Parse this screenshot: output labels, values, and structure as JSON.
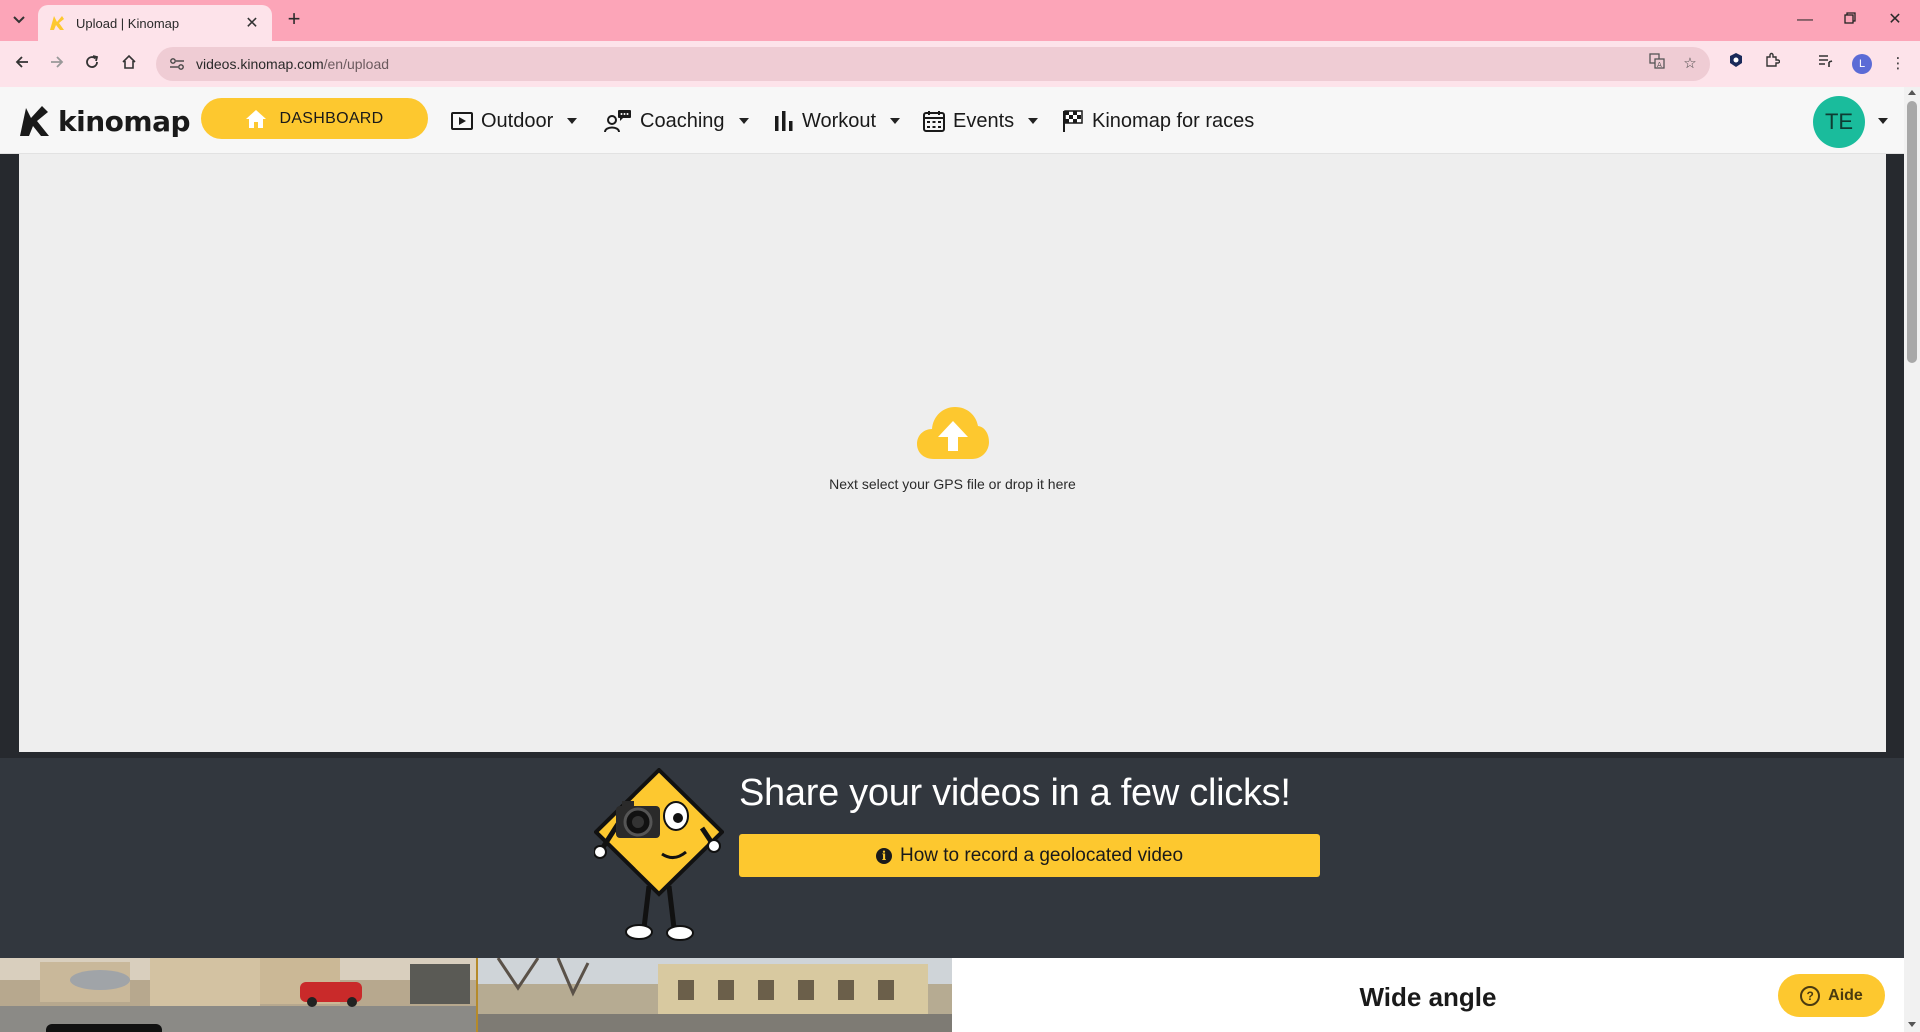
{
  "browser": {
    "tab": {
      "title": "Upload | Kinomap",
      "favicon": "kinomap-favicon"
    },
    "url": {
      "host": "videos.kinomap.com",
      "path": "/en/upload"
    },
    "profile_initial": "L"
  },
  "header": {
    "logo_text": "kinomap",
    "dashboard_label": "DASHBOARD",
    "nav": [
      {
        "label": "Outdoor",
        "icon": "play-square-icon"
      },
      {
        "label": "Coaching",
        "icon": "coach-chat-icon"
      },
      {
        "label": "Workout",
        "icon": "bar-chart-icon"
      },
      {
        "label": "Events",
        "icon": "calendar-icon"
      },
      {
        "label": "Kinomap for races",
        "icon": "checkered-flag-icon"
      }
    ],
    "avatar_initials": "TE"
  },
  "upload": {
    "icon": "cloud-upload-icon",
    "text": "Next select your GPS file or drop it here"
  },
  "promo": {
    "title": "Share your videos in a few clicks!",
    "button_label": "How to record a geolocated video"
  },
  "bottom": {
    "wide_angle_title": "Wide angle",
    "help_label": "Aide"
  },
  "colors": {
    "accent": "#fdc82f",
    "avatar": "#1abc9c",
    "promo_bg": "#32373e",
    "chrome_tab": "#fca5b8"
  }
}
